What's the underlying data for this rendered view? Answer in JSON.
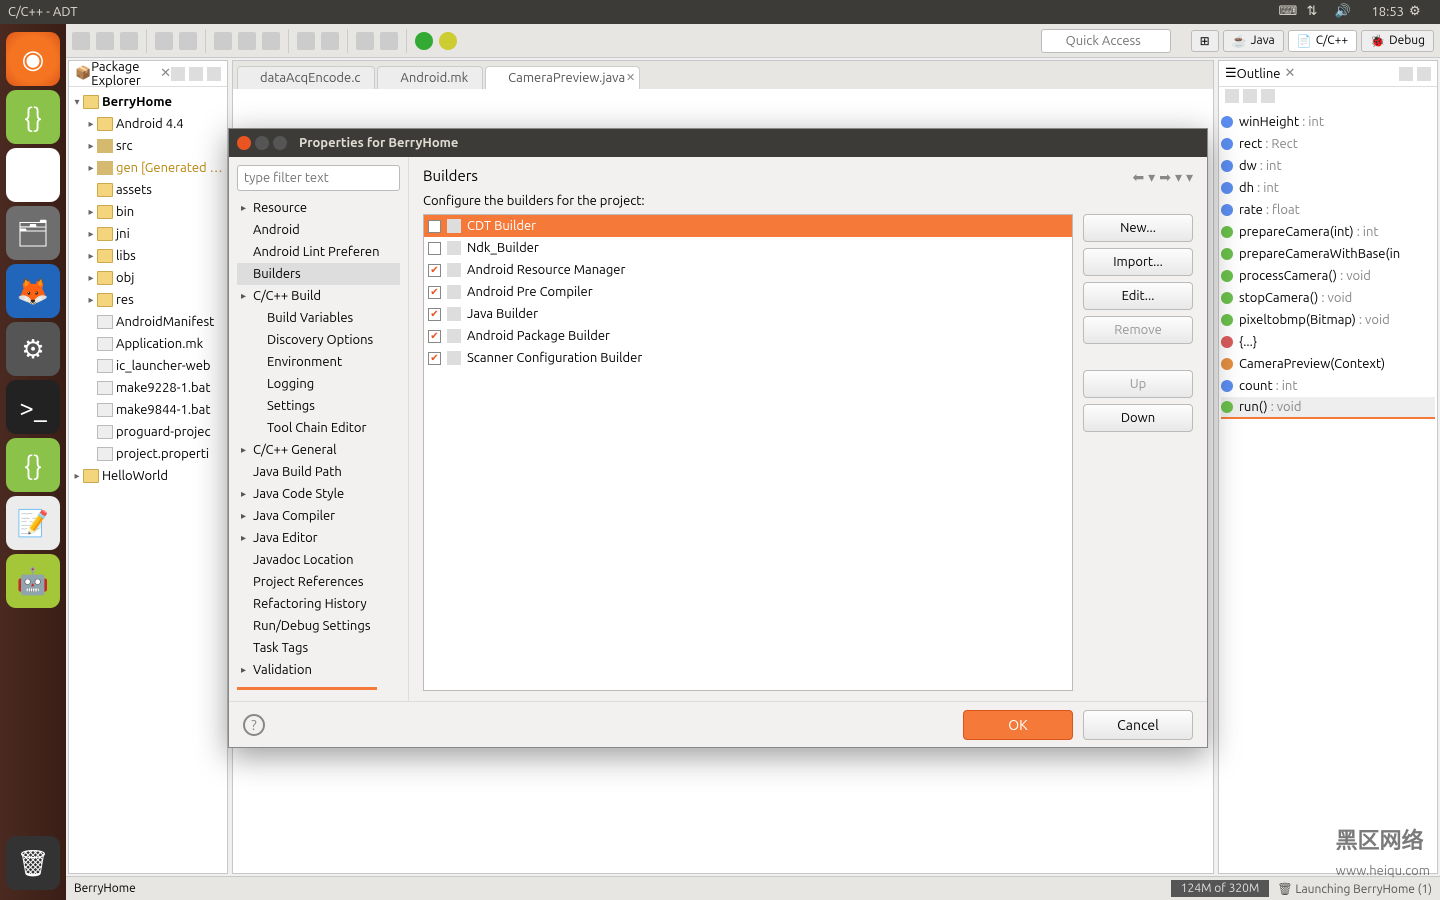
{
  "menubar": {
    "title": "C/C++ - ADT",
    "time": "18:53"
  },
  "toolbar": {
    "quick_access": "Quick Access"
  },
  "perspectives": {
    "java": "Java",
    "cpp": "C/C++",
    "debug": "Debug"
  },
  "explorer": {
    "title": "Package Explorer",
    "project": "BerryHome",
    "items": [
      {
        "label": "Android 4.4",
        "icon": "lib",
        "exp": true
      },
      {
        "label": "src",
        "icon": "pkg",
        "exp": true
      },
      {
        "label": "gen [Generated …",
        "icon": "pkg",
        "exp": true,
        "gray": true
      },
      {
        "label": "assets",
        "icon": "folder",
        "exp": false
      },
      {
        "label": "bin",
        "icon": "folder",
        "exp": true
      },
      {
        "label": "jni",
        "icon": "folder",
        "exp": true
      },
      {
        "label": "libs",
        "icon": "folder",
        "exp": true
      },
      {
        "label": "obj",
        "icon": "folder",
        "exp": true
      },
      {
        "label": "res",
        "icon": "folder",
        "exp": true
      },
      {
        "label": "AndroidManifest",
        "icon": "file",
        "exp": false
      },
      {
        "label": "Application.mk",
        "icon": "file",
        "exp": false
      },
      {
        "label": "ic_launcher-web",
        "icon": "file",
        "exp": false
      },
      {
        "label": "make9228-1.bat",
        "icon": "file",
        "exp": false
      },
      {
        "label": "make9844-1.bat",
        "icon": "file",
        "exp": false
      },
      {
        "label": "proguard-projec",
        "icon": "file",
        "exp": false
      },
      {
        "label": "project.properti",
        "icon": "file",
        "exp": false
      }
    ],
    "project2": "HelloWorld"
  },
  "editor": {
    "tabs": [
      {
        "label": "dataAcqEncode.c",
        "active": false
      },
      {
        "label": "Android.mk",
        "active": false
      },
      {
        "label": "CameraPreview.java",
        "active": true
      }
    ]
  },
  "outline": {
    "title": "Outline",
    "items": [
      {
        "dot": "b",
        "name": "winHeight",
        "ret": ": int"
      },
      {
        "dot": "b",
        "name": "rect",
        "ret": ": Rect"
      },
      {
        "dot": "b",
        "name": "dw",
        "ret": ": int"
      },
      {
        "dot": "b",
        "name": "dh",
        "ret": ": int"
      },
      {
        "dot": "b",
        "name": "rate",
        "ret": ": float"
      },
      {
        "dot": "g",
        "name": "prepareCamera(int)",
        "ret": ": int"
      },
      {
        "dot": "g",
        "name": "prepareCameraWithBase(in",
        "ret": ""
      },
      {
        "dot": "g",
        "name": "processCamera()",
        "ret": ": void"
      },
      {
        "dot": "g",
        "name": "stopCamera()",
        "ret": ": void"
      },
      {
        "dot": "g",
        "name": "pixeltobmp(Bitmap)",
        "ret": ": void"
      },
      {
        "dot": "r",
        "name": "{...}",
        "ret": ""
      },
      {
        "dot": "o",
        "name": "CameraPreview(Context)",
        "ret": ""
      },
      {
        "dot": "b",
        "name": "count",
        "ret": ": int"
      },
      {
        "dot": "g",
        "name": "run()",
        "ret": ": void",
        "sel": true
      }
    ]
  },
  "status": {
    "project": "BerryHome",
    "mem": "124M of 320M",
    "launch": "Launching BerryHome (1)",
    "wm": "黑区网络",
    "url": "www.heiqu.com"
  },
  "dialog": {
    "title": "Properties for BerryHome",
    "filter_placeholder": "type filter text",
    "categories": [
      {
        "label": "Resource",
        "exp": true
      },
      {
        "label": "Android"
      },
      {
        "label": "Android Lint Preferen"
      },
      {
        "label": "Builders",
        "sel": true
      },
      {
        "label": "C/C++ Build",
        "exp": true
      },
      {
        "label": "Build Variables",
        "sub": true
      },
      {
        "label": "Discovery Options",
        "sub": true
      },
      {
        "label": "Environment",
        "sub": true
      },
      {
        "label": "Logging",
        "sub": true
      },
      {
        "label": "Settings",
        "sub": true
      },
      {
        "label": "Tool Chain Editor",
        "sub": true
      },
      {
        "label": "C/C++ General",
        "exp": true
      },
      {
        "label": "Java Build Path"
      },
      {
        "label": "Java Code Style",
        "exp": true
      },
      {
        "label": "Java Compiler",
        "exp": true
      },
      {
        "label": "Java Editor",
        "exp": true
      },
      {
        "label": "Javadoc Location"
      },
      {
        "label": "Project References"
      },
      {
        "label": "Refactoring History"
      },
      {
        "label": "Run/Debug Settings"
      },
      {
        "label": "Task Tags"
      },
      {
        "label": "Validation",
        "exp": true
      }
    ],
    "heading": "Builders",
    "config_label": "Configure the builders for the project:",
    "builders": [
      {
        "label": "CDT Builder",
        "checked": true,
        "sel": true
      },
      {
        "label": "Ndk_Builder",
        "checked": false
      },
      {
        "label": "Android Resource Manager",
        "checked": true
      },
      {
        "label": "Android Pre Compiler",
        "checked": true
      },
      {
        "label": "Java Builder",
        "checked": true
      },
      {
        "label": "Android Package Builder",
        "checked": true
      },
      {
        "label": "Scanner Configuration Builder",
        "checked": true
      }
    ],
    "buttons": {
      "new": "New...",
      "import": "Import...",
      "edit": "Edit...",
      "remove": "Remove",
      "up": "Up",
      "down": "Down",
      "ok": "OK",
      "cancel": "Cancel"
    }
  }
}
